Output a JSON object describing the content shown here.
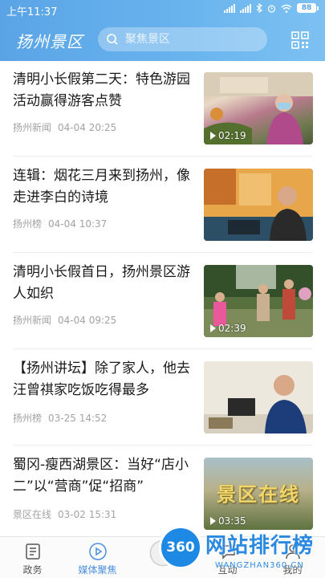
{
  "status_bar": {
    "time": "上午11:37",
    "battery": "88"
  },
  "header": {
    "logo": "扬州景区",
    "search_placeholder": "聚焦景区"
  },
  "news": [
    {
      "title": "清明小长假第二天：特色游园活动赢得游客点赞",
      "source": "扬州新闻",
      "date": "04-04 20:25",
      "duration": "02:19"
    },
    {
      "title": "连辑：烟花三月来到扬州，像走进李白的诗境",
      "source": "扬州榜",
      "date": "04-04 10:37",
      "duration": ""
    },
    {
      "title": "清明小长假首日，扬州景区游人如织",
      "source": "扬州新闻",
      "date": "04-04 09:25",
      "duration": "02:39"
    },
    {
      "title": "【扬州讲坛】除了家人，他去汪曾祺家吃饭吃得最多",
      "source": "扬州榜",
      "date": "03-25 14:52",
      "duration": ""
    },
    {
      "title": "蜀冈-瘦西湖景区：当好“店小二”以“营商”促“招商”",
      "source": "景区在线",
      "date": "03-02 15:31",
      "duration": "03:35",
      "thumb_text": "景区在线"
    }
  ],
  "bottom_nav": [
    {
      "label": "政务",
      "icon": "document-icon",
      "active": false
    },
    {
      "label": "媒体聚焦",
      "icon": "play-circle-icon",
      "active": true
    },
    {
      "label": "",
      "icon": "center-logo-icon",
      "active": false
    },
    {
      "label": "互动",
      "icon": "chat-icon",
      "active": false
    },
    {
      "label": "我的",
      "icon": "user-icon",
      "active": false
    }
  ],
  "watermark": {
    "badge": "360",
    "text": "网站排行榜",
    "url": "WANGZHAN360.CN"
  },
  "colors": {
    "header_blue": "#5aa4e6",
    "active_tab": "#4a8fdd",
    "meta_gray": "#a3a3a3"
  }
}
